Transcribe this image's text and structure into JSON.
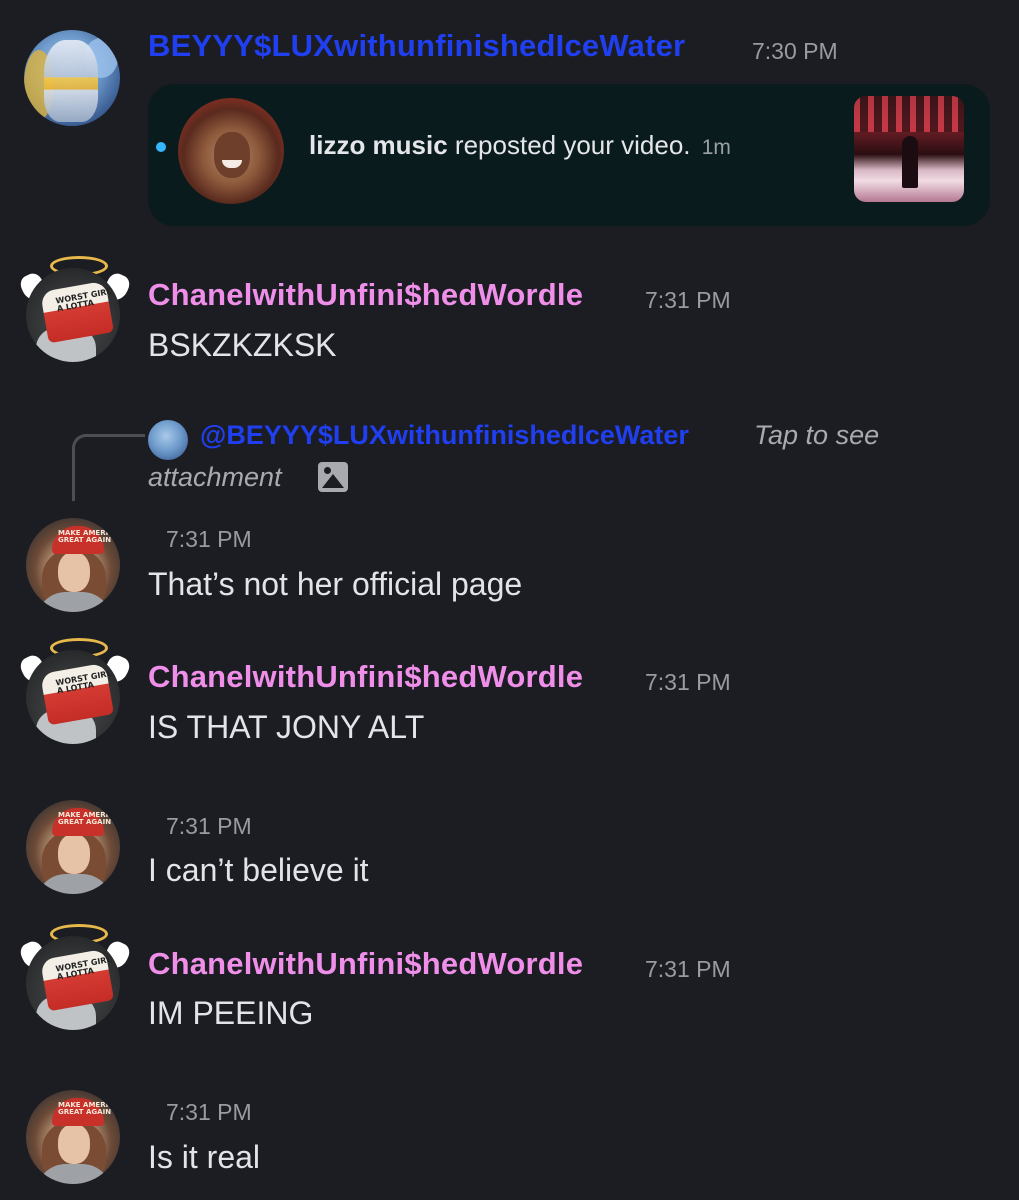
{
  "colors": {
    "background": "#1c1d22",
    "username_blue": "#1f3ff0",
    "username_pink": "#ef8fe9",
    "card_bg": "#0a1b1e",
    "unread_dot": "#35b6ff"
  },
  "messages": [
    {
      "username": "BEYYY$LUXwithunfinishedIceWater",
      "time": "7:30 PM",
      "embed": {
        "account": "lizzo music",
        "action": " reposted your video.",
        "ago": "1m"
      }
    },
    {
      "username": "ChanelwithUnfini$hedWordle",
      "time": "7:31 PM",
      "text": "BSKZKZKSK",
      "hat_text": "WORST GIRL A LOTTA"
    },
    {
      "reply": {
        "mention": "@BEYYY$LUXwithunfinishedIceWater",
        "tap_text": "Tap to see",
        "attachment_text": "attachment"
      },
      "time": "7:31 PM",
      "text": "That’s not her official page",
      "cap_text": "MAKE AMERICA GREAT AGAIN"
    },
    {
      "username": "ChanelwithUnfini$hedWordle",
      "time": "7:31 PM",
      "text": "IS THAT JONY ALT",
      "hat_text": "WORST GIRL A LOTTA"
    },
    {
      "time": "7:31 PM",
      "text": "I can’t believe it",
      "cap_text": "MAKE AMERICA GREAT AGAIN"
    },
    {
      "username": "ChanelwithUnfini$hedWordle",
      "time": "7:31 PM",
      "text": "IM PEEING",
      "hat_text": "WORST GIRL A LOTTA"
    },
    {
      "time": "7:31 PM",
      "text": "Is it real",
      "cap_text": "MAKE AMERICA GREAT AGAIN"
    }
  ]
}
